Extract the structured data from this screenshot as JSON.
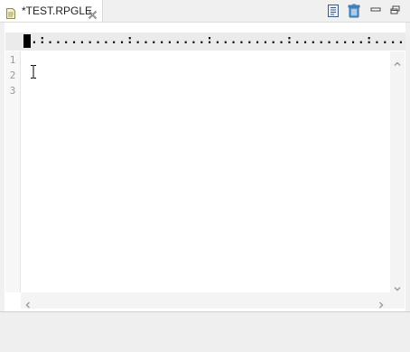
{
  "tab": {
    "title": "*TEST.RPGLE",
    "icon": "file-icon",
    "close_icon": "close-icon"
  },
  "toolbar": {
    "buttons": [
      "outline-icon",
      "trash-icon",
      "minimize-icon",
      "restore-icon"
    ]
  },
  "ruler": {
    "dots": ".:..........:.........:.........:.........:.........:..........."
  },
  "editor": {
    "lines": [
      "1",
      "2",
      "3"
    ]
  },
  "scrollbar": {
    "up": "chevron-up-icon",
    "down": "chevron-down-icon",
    "left": "chevron-left-icon",
    "right": "chevron-right-icon"
  },
  "colors": {
    "background": "#f0f0f0",
    "editor": "#ffffff",
    "ruler": "#ebebeb"
  }
}
